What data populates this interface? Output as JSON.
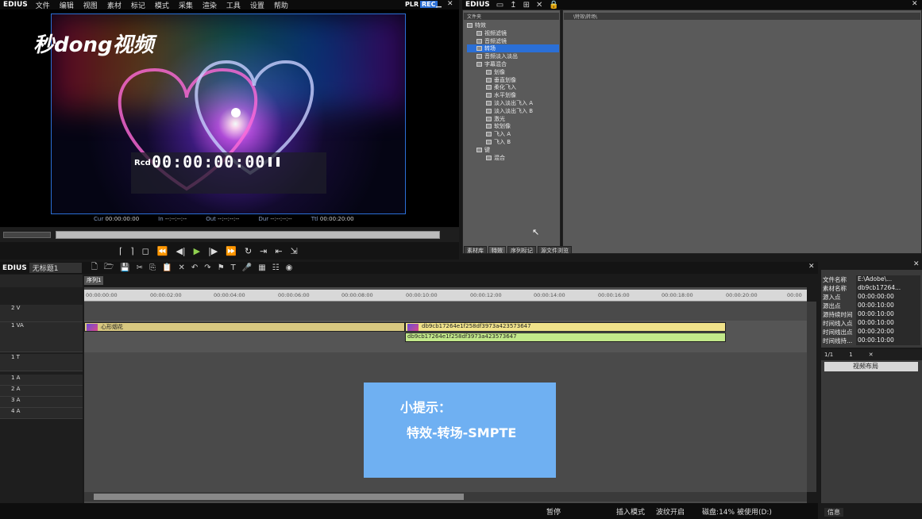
{
  "menubar": {
    "brand": "EDIUS",
    "items": [
      "文件",
      "编辑",
      "视图",
      "素材",
      "标记",
      "模式",
      "采集",
      "渲染",
      "工具",
      "设置",
      "帮助"
    ],
    "plr": "PLR",
    "rec": "REC"
  },
  "preview": {
    "logo": "秒dong视频",
    "rcd_label": "Rcd",
    "timecode": "00:00:00:00",
    "cur_label": "Cur",
    "cur_value": "00:00:00:00",
    "in_label": "In",
    "in_value": "--:--:--:--",
    "out_label": "Out",
    "out_value": "--:--:--:--",
    "dur_label": "Dur",
    "dur_value": "--:--:--:--",
    "ttl_label": "Ttl",
    "ttl_value": "00:00:20:00"
  },
  "effects_panel": {
    "brand": "EDIUS",
    "tree_header": "文件夹",
    "content_header": "\\特效\\转场\\",
    "tree": [
      {
        "label": "特效",
        "level": 0
      },
      {
        "label": "视频滤镜",
        "level": 1
      },
      {
        "label": "音频滤镜",
        "level": 1
      },
      {
        "label": "转场",
        "level": 1,
        "selected": true
      },
      {
        "label": "音频淡入淡出",
        "level": 1
      },
      {
        "label": "字幕混合",
        "level": 1
      },
      {
        "label": "划像",
        "level": 2
      },
      {
        "label": "垂直划像",
        "level": 2
      },
      {
        "label": "柔化飞入",
        "level": 2
      },
      {
        "label": "水平划像",
        "level": 2
      },
      {
        "label": "淡入淡出飞入 A",
        "level": 2
      },
      {
        "label": "淡入淡出飞入 B",
        "level": 2
      },
      {
        "label": "激光",
        "level": 2
      },
      {
        "label": "软划像",
        "level": 2
      },
      {
        "label": "飞入 A",
        "level": 2
      },
      {
        "label": "飞入 B",
        "level": 2
      },
      {
        "label": "键",
        "level": 1
      },
      {
        "label": "混合",
        "level": 2
      }
    ],
    "tabs": [
      "素材库",
      "特效",
      "序列标记",
      "源文件浏览"
    ]
  },
  "timeline": {
    "brand": "EDIUS",
    "project": "无标题1",
    "sequence_tab": "序列1",
    "ruler": [
      "00:00:00:00",
      "00:00:02:00",
      "00:00:04:00",
      "00:00:06:00",
      "00:00:08:00",
      "00:00:10:00",
      "00:00:12:00",
      "00:00:14:00",
      "00:00:16:00",
      "00:00:18:00",
      "00:00:20:00",
      "00:00"
    ],
    "tracks": [
      "2 V",
      "1 VA",
      "1 T",
      "1 A",
      "2 A",
      "3 A",
      "4 A"
    ],
    "clip1": "心形烟花",
    "clip2": "db9cb17264e1f258df3973a423573647",
    "clip3": "db9cb17264e1f258df3973a423573647"
  },
  "tip": {
    "line1": "小提示：",
    "line2": "特效-转场-SMPTE"
  },
  "status": {
    "paused": "暂停",
    "insert_mode": "插入模式",
    "ripple": "波纹开启",
    "disk": "磁盘:14% 被使用(D:)"
  },
  "info_panel": {
    "rows": [
      {
        "k": "文件名称",
        "v": "E:\\Adobe\\..."
      },
      {
        "k": "素材名称",
        "v": "db9cb17264..."
      },
      {
        "k": "源入点",
        "v": "00:00:00:00"
      },
      {
        "k": "源出点",
        "v": "00:00:10:00"
      },
      {
        "k": "源持续时间",
        "v": "00:00:10:00"
      },
      {
        "k": "时间线入点",
        "v": "00:00:10:00"
      },
      {
        "k": "时间线出点",
        "v": "00:00:20:00"
      },
      {
        "k": "时间线持...",
        "v": "00:00:10:00"
      }
    ],
    "bin_page": "1/1",
    "bin_count": "1",
    "bin_item": "视频布局",
    "tab": "信息"
  }
}
